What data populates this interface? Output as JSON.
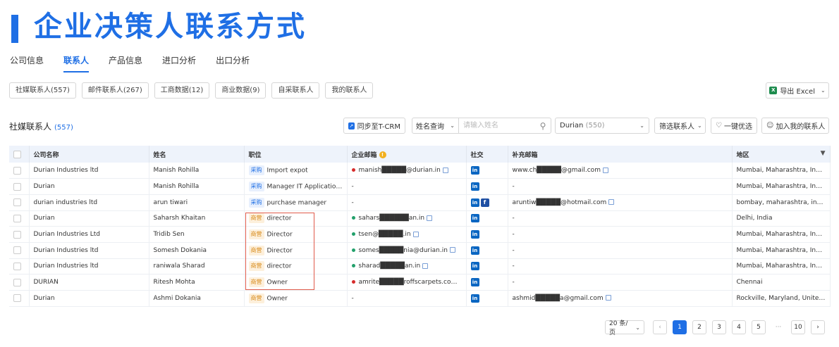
{
  "header": {
    "title": "企业决策人联系方式"
  },
  "tabs": [
    "公司信息",
    "联系人",
    "产品信息",
    "进口分析",
    "出口分析"
  ],
  "subtabs": [
    "社媒联系人(557)",
    "邮件联系人(267)",
    "工商数据(12)",
    "商业数据(9)",
    "自采联系人",
    "我的联系人"
  ],
  "export_label": "导出 Excel",
  "section": {
    "title": "社媒联系人",
    "count": "(557)"
  },
  "toolbar": {
    "sync_label": "同步至T-CRM",
    "name_query": "姓名查询",
    "name_placeholder": "请输入姓名",
    "company_select": "Durian",
    "company_select_count": "(550)",
    "filter_label": "筛选联系人",
    "one_click": "一键优选",
    "add_mine": "加入我的联系人"
  },
  "table": {
    "headers": [
      "公司名称",
      "姓名",
      "职位",
      "企业邮箱",
      "社交",
      "补充邮箱",
      "地区"
    ],
    "rows": [
      {
        "company": "Durian Industries ltd",
        "name": "Manish Rohilla",
        "tag": "采购",
        "tag_type": "buy",
        "title": "Import expot",
        "email": "manish█████@durian.in",
        "email_status": "red",
        "social": [
          "in"
        ],
        "extra_email": "www.ch█████@gmail.com",
        "region": "Mumbai, Maharashtra, India"
      },
      {
        "company": "Durian",
        "name": "Manish Rohilla",
        "tag": "采购",
        "tag_type": "buy",
        "title": "Manager IT Applications...",
        "email": "-",
        "email_status": "",
        "social": [
          "in"
        ],
        "extra_email": "-",
        "region": "Mumbai, Maharashtra, India"
      },
      {
        "company": "durian industries ltd",
        "name": "arun tiwari",
        "tag": "采购",
        "tag_type": "buy",
        "title": "purchase manager",
        "email": "-",
        "email_status": "",
        "social": [
          "in",
          "f"
        ],
        "extra_email": "aruntiw█████@hotmail.com",
        "region": "bombay, maharashtra, india"
      },
      {
        "company": "Durian",
        "name": "Saharsh Khaitan",
        "tag": "商营",
        "tag_type": "biz",
        "title": "director",
        "email": "sahars██████an.in",
        "email_status": "green",
        "social": [
          "in"
        ],
        "extra_email": "-",
        "region": "Delhi, India"
      },
      {
        "company": "Durian Industries Ltd",
        "name": "Tridib Sen",
        "tag": "商营",
        "tag_type": "biz",
        "title": "Director",
        "email": "tsen@█████.in",
        "email_status": "green",
        "social": [
          "in"
        ],
        "extra_email": "-",
        "region": "Mumbai, Maharashtra, India"
      },
      {
        "company": "Durian Industries ltd",
        "name": "Somesh Dokania",
        "tag": "商营",
        "tag_type": "biz",
        "title": "Director",
        "email": "somes█████nia@durian.in",
        "email_status": "green",
        "social": [
          "in"
        ],
        "extra_email": "-",
        "region": "Mumbai, Maharashtra, India"
      },
      {
        "company": "Durian Industries ltd",
        "name": "raniwala Sharad",
        "tag": "商营",
        "tag_type": "biz",
        "title": "director",
        "email": "sharad█████an.in",
        "email_status": "green",
        "social": [
          "in"
        ],
        "extra_email": "-",
        "region": "Mumbai, Maharashtra, India"
      },
      {
        "company": "DURIAN",
        "name": "Ritesh Mohta",
        "tag": "商营",
        "tag_type": "biz",
        "title": "Owner",
        "email": "amrite█████roffscarpets.com",
        "email_status": "red",
        "social": [
          "in"
        ],
        "extra_email": "-",
        "region": "Chennai"
      },
      {
        "company": "Durian",
        "name": "Ashmi Dokania",
        "tag": "商营",
        "tag_type": "biz",
        "title": "Owner",
        "email": "-",
        "email_status": "",
        "social": [
          "in"
        ],
        "extra_email": "ashmid█████a@gmail.com",
        "region": "Rockville, Maryland, United ..."
      }
    ]
  },
  "pager": {
    "page_size": "20 条/页",
    "pages": [
      "1",
      "2",
      "3",
      "4",
      "5"
    ],
    "ellipsis": "···",
    "last": "10",
    "current": "1"
  }
}
